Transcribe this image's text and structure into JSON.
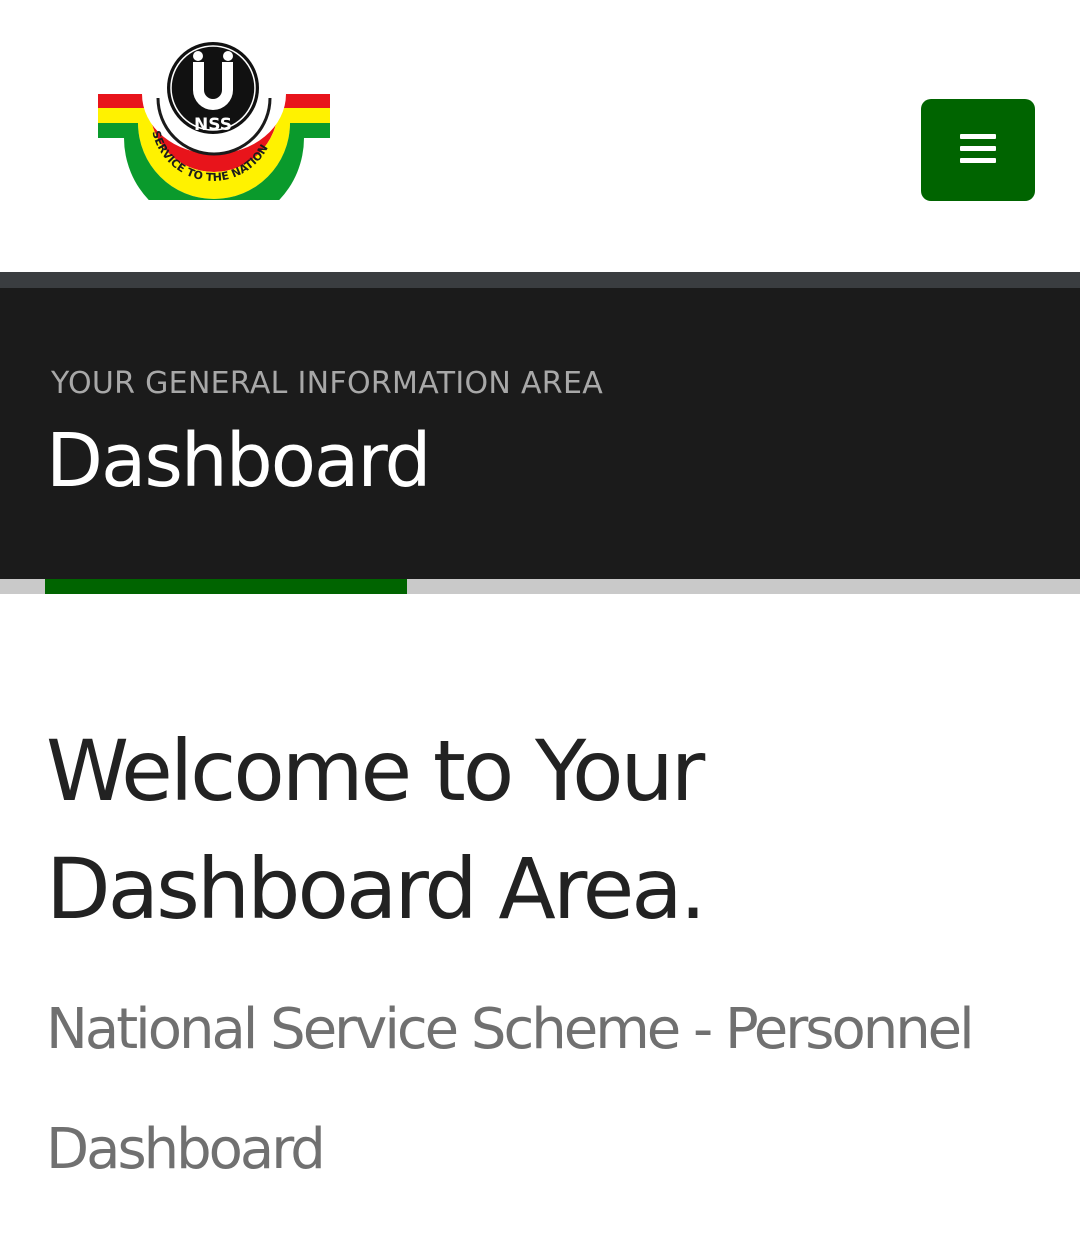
{
  "header": {
    "logo_text": "NSS",
    "logo_motto": "SERVICE TO THE NATION",
    "menu_icon": "hamburger-icon",
    "colors": {
      "menu_button": "#006400",
      "logo_red": "#e8141b",
      "logo_yellow": "#fff200",
      "logo_green": "#0a9a2c"
    }
  },
  "hero": {
    "subtitle": "YOUR GENERAL INFORMATION AREA",
    "title": "Dashboard"
  },
  "main": {
    "welcome": "Welcome to Your Dashboard Area.",
    "tagline": "National Service Scheme - Personnel Dashboard"
  }
}
